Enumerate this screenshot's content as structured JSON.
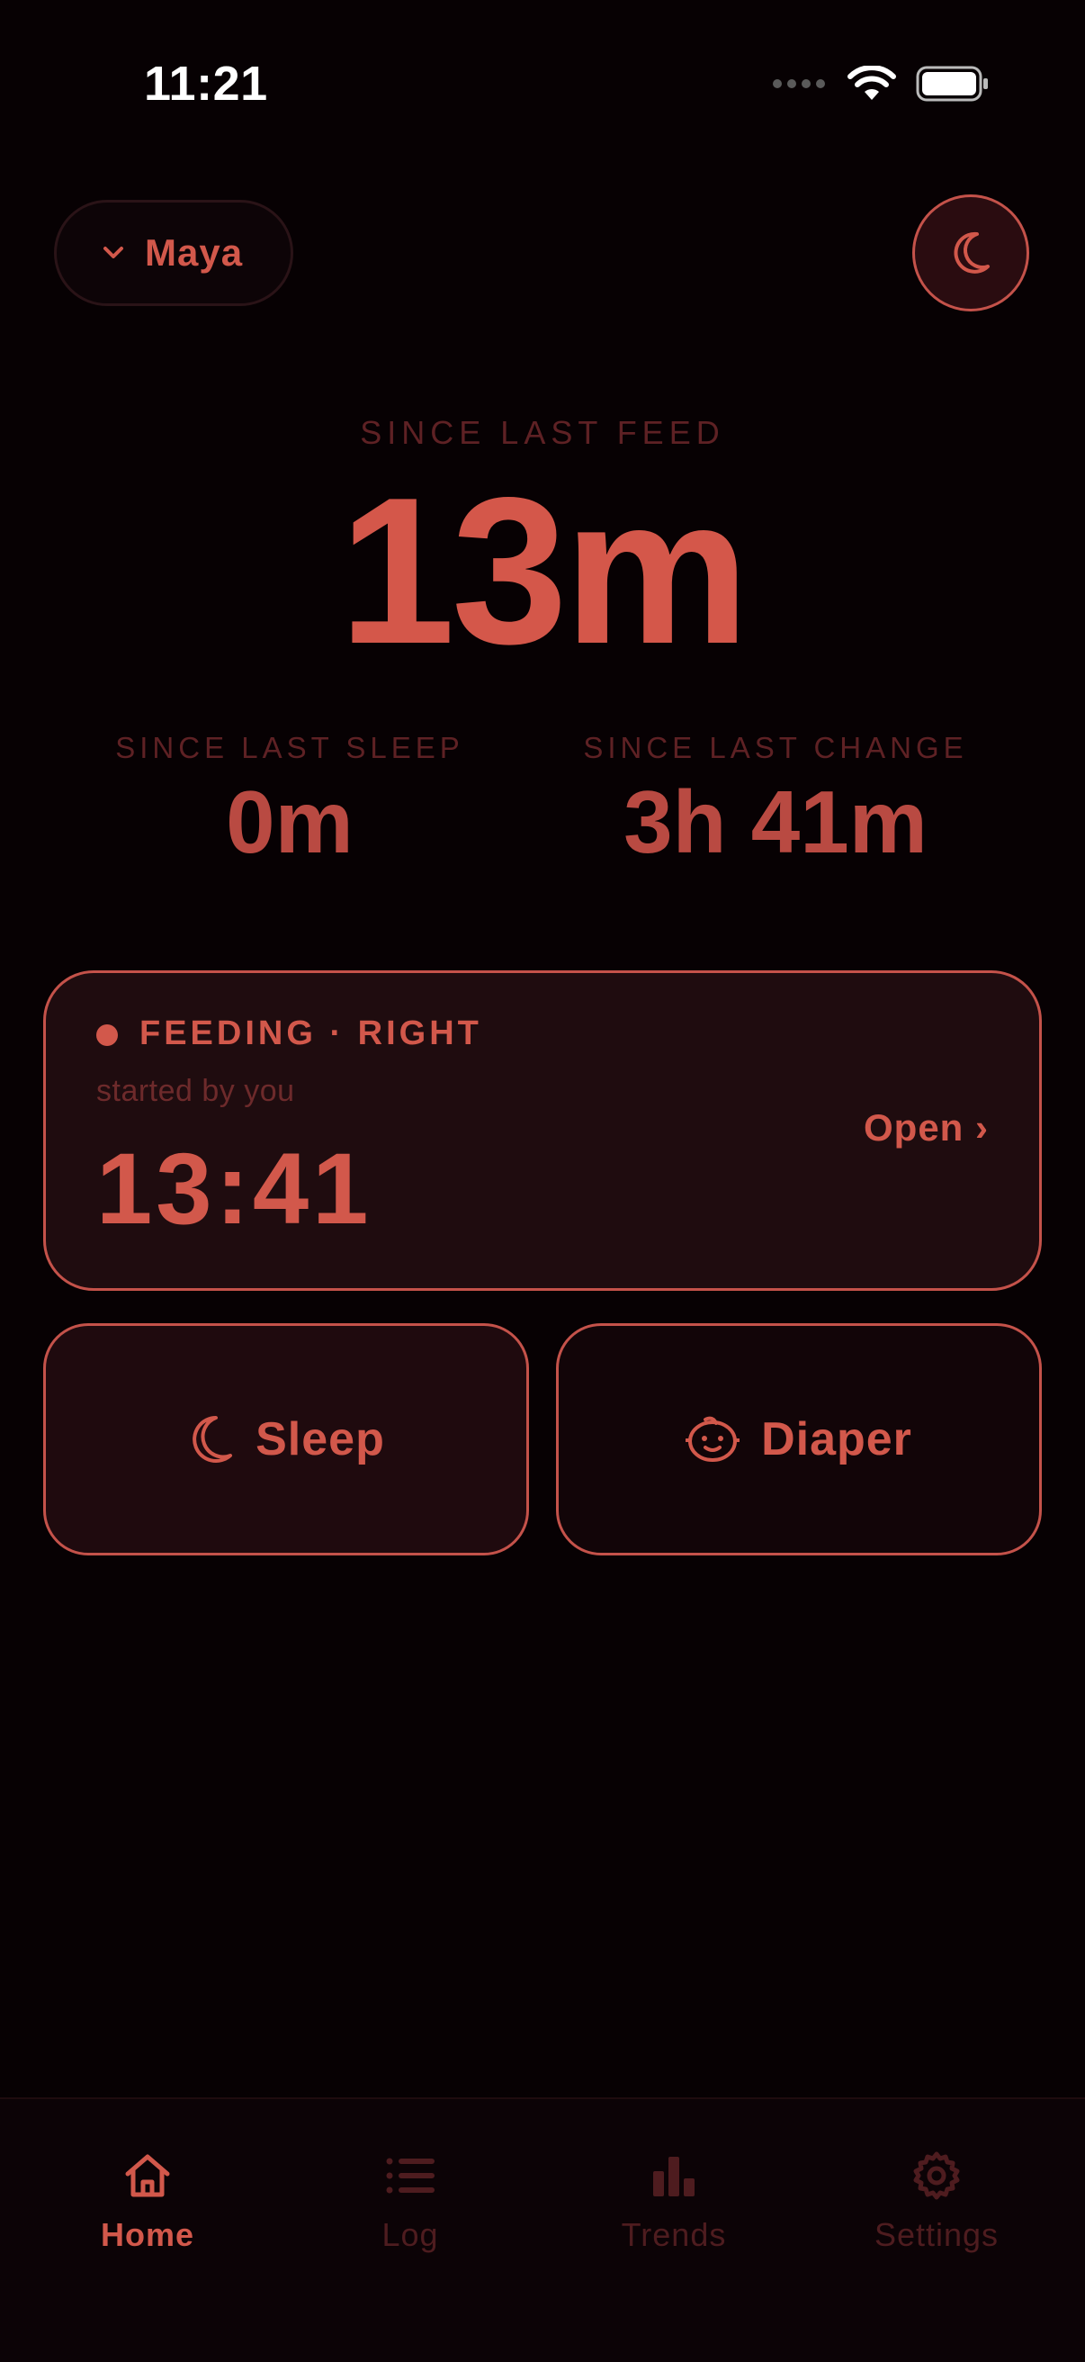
{
  "status_bar": {
    "time": "11:21"
  },
  "header": {
    "child_name": "Maya"
  },
  "main": {
    "feed_label": "SINCE LAST FEED",
    "feed_value": "13m",
    "sleep_label": "SINCE LAST SLEEP",
    "sleep_value": "0m",
    "change_label": "SINCE LAST CHANGE",
    "change_value": "3h 41m"
  },
  "active_session": {
    "title": "FEEDING · RIGHT",
    "subtitle": "started by you",
    "timer": "13:41",
    "open_label": "Open ›"
  },
  "quick_actions": {
    "sleep_label": "Sleep",
    "diaper_label": "Diaper"
  },
  "tabs": [
    {
      "label": "Home",
      "icon": "home-icon",
      "active": true
    },
    {
      "label": "Log",
      "icon": "list-icon",
      "active": false
    },
    {
      "label": "Trends",
      "icon": "bar-chart-icon",
      "active": false
    },
    {
      "label": "Settings",
      "icon": "gear-icon",
      "active": false
    }
  ],
  "colors": {
    "accent": "#d2584b",
    "background": "#070103",
    "muted": "#5e2124",
    "card": "#1f0c0f"
  }
}
